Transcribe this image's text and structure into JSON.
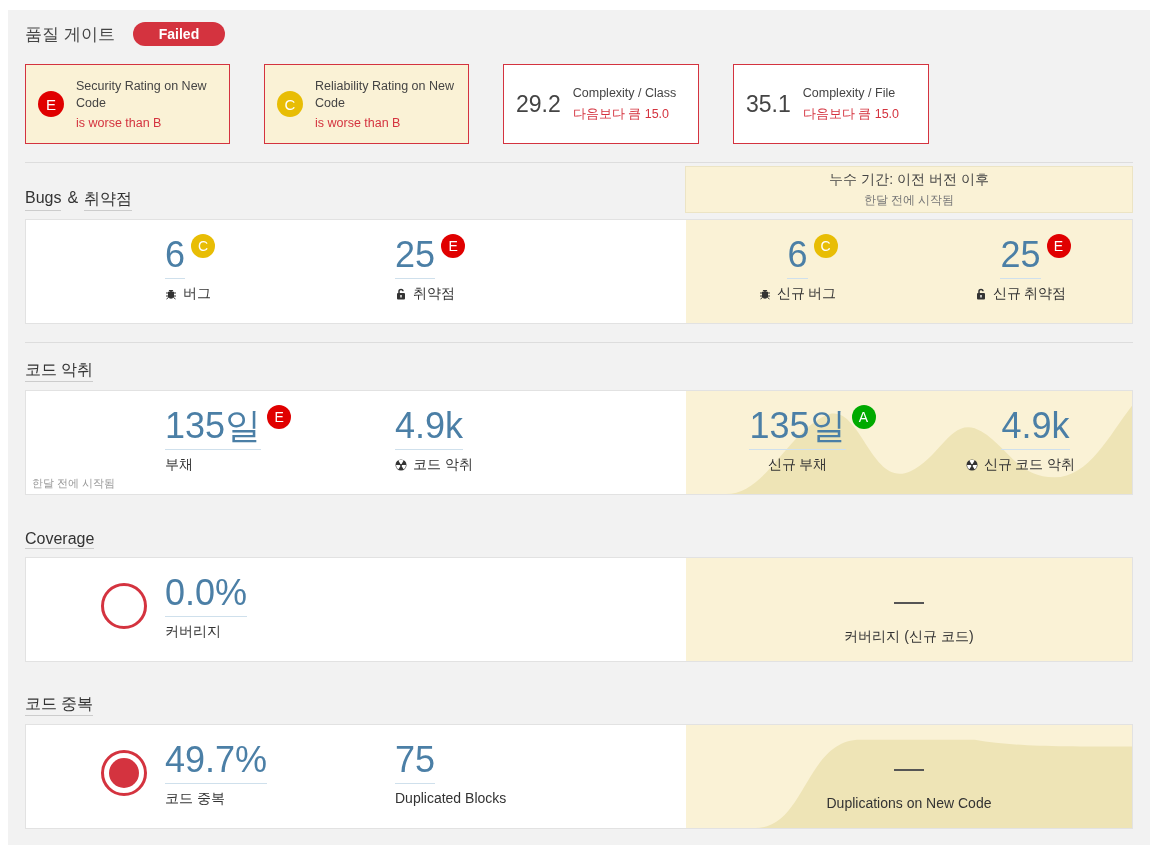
{
  "quality_gate": {
    "title": "품질 게이트",
    "status": "Failed"
  },
  "conditions": [
    {
      "kind": "rating",
      "rating": "E",
      "color": "#e00000",
      "label": "Security Rating on New Code",
      "detail": "is worse than B"
    },
    {
      "kind": "rating",
      "rating": "C",
      "color": "#e8bd05",
      "label": "Reliability Rating on New Code",
      "detail": "is worse than B"
    },
    {
      "kind": "value",
      "value": "29.2",
      "label": "Complexity / Class",
      "detail": "다음보다 큼 15.0"
    },
    {
      "kind": "value",
      "value": "35.1",
      "label": "Complexity / File",
      "detail": "다음보다 큼 15.0"
    }
  ],
  "sections": [
    {
      "kind": "reliability",
      "title": [
        {
          "kind": "link",
          "text": "Bugs"
        },
        {
          "kind": "text",
          "text": "&"
        },
        {
          "kind": "link",
          "text": "취약점"
        }
      ],
      "leak_period": {
        "title": "누수 기간: 이전 버전 이후",
        "subtitle": "한달 전에 시작됨"
      },
      "measures": [
        {
          "kind": "bugs",
          "value": "6",
          "rating": "C",
          "color": "#e8bd05",
          "label": "버그"
        },
        {
          "kind": "vulnerabilities",
          "value": "25",
          "rating": "E",
          "color": "#e00000",
          "label": "취약점"
        }
      ],
      "new_measures": [
        {
          "kind": "bugs",
          "value": "6",
          "rating": "C",
          "color": "#e8bd05",
          "label": "신규 버그"
        },
        {
          "kind": "vulnerabilities",
          "value": "25",
          "rating": "E",
          "color": "#e00000",
          "label": "신규 취약점"
        }
      ]
    },
    {
      "kind": "maintainability",
      "title": [
        {
          "kind": "link",
          "text": "코드 악취"
        }
      ],
      "note": "한달 전에 시작됨",
      "measures": [
        {
          "kind": "debt",
          "value": "135일",
          "rating": "E",
          "color": "#e00000",
          "label": "부채"
        },
        {
          "kind": "smells",
          "value": "4.9k",
          "label": "코드 악취"
        }
      ],
      "new_measures": [
        {
          "kind": "debt",
          "value": "135일",
          "rating": "A",
          "color": "#00aa00",
          "label": "신규 부채"
        },
        {
          "kind": "smells",
          "value": "4.9k",
          "label": "신규 코드 악취"
        }
      ]
    },
    {
      "kind": "coverage",
      "title": [
        {
          "kind": "link",
          "text": "Coverage"
        }
      ],
      "measures": [
        {
          "kind": "coverage",
          "value": "0.0%",
          "label": "커버리지"
        }
      ],
      "new_measures": [
        {
          "kind": "none",
          "dash": "—",
          "label": "커버리지 (신규 코드)"
        }
      ]
    },
    {
      "kind": "duplications",
      "title": [
        {
          "kind": "link",
          "text": "코드 중복"
        }
      ],
      "measures": [
        {
          "kind": "duplications",
          "value": "49.7%",
          "label": "코드 중복"
        },
        {
          "kind": "blocks",
          "value": "75",
          "label": "Duplicated Blocks"
        }
      ],
      "new_measures": [
        {
          "kind": "none",
          "dash": "—",
          "label": "Duplications on New Code"
        }
      ]
    }
  ]
}
